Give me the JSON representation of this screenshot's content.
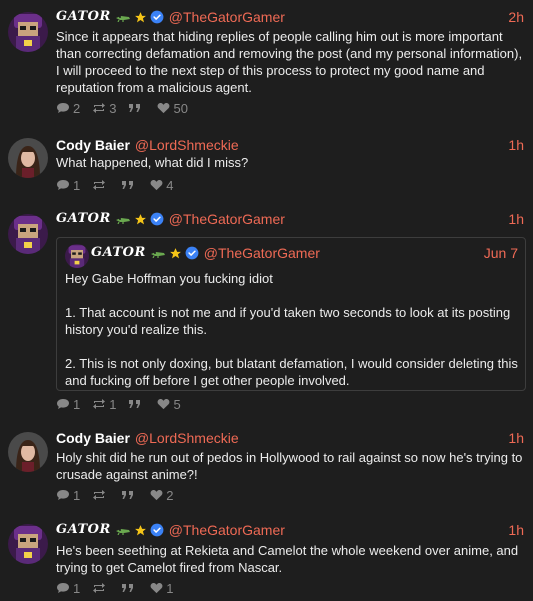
{
  "posts": [
    {
      "author": "GATOR",
      "handle": "@TheGatorGamer",
      "time": "2h",
      "text": [
        "Since it appears that hiding replies of people calling him out is more important than correcting defamation and removing the post (and my personal information), I will proceed to the next step of this process to protect my good name and reputation from a malicious agent."
      ],
      "replies": "2",
      "reposts": "3",
      "likes": "50"
    },
    {
      "author": "Cody Baier",
      "handle": "@LordShmeckie",
      "time": "1h",
      "text": [
        "What happened, what did I miss?"
      ],
      "replies": "1",
      "reposts": "",
      "likes": "4"
    },
    {
      "author": "GATOR",
      "handle": "@TheGatorGamer",
      "time": "1h",
      "replies": "1",
      "reposts": "1",
      "likes": "5",
      "quote": {
        "author": "GATOR",
        "handle": "@TheGatorGamer",
        "time": "Jun 7",
        "text": [
          "Hey Gabe Hoffman you fucking idiot",
          "1. That account is not me and if you'd taken two seconds to look at its posting history you'd realize this.",
          "2. This is not only doxing, but blatant defamation, I would consider deleting this and fucking off before I get other people involved."
        ]
      }
    },
    {
      "author": "Cody Baier",
      "handle": "@LordShmeckie",
      "time": "1h",
      "text": [
        "Holy shit did he run out of pedos in Hollywood to rail against so now he's trying to crusade against anime?!"
      ],
      "replies": "1",
      "reposts": "",
      "likes": "2"
    },
    {
      "author": "GATOR",
      "handle": "@TheGatorGamer",
      "time": "1h",
      "text": [
        "He's been seething at Rekieta and Camelot the whole weekend over anime, and trying to get Camelot fired from Nascar."
      ],
      "replies": "1",
      "reposts": "",
      "likes": "1"
    }
  ],
  "icons": {
    "reply": "speech-bubble-icon",
    "repost": "repost-arrows-icon",
    "quote": "quote-marks-icon",
    "like": "heart-icon",
    "verified": "verified-check-icon",
    "star": "star-icon",
    "gator_emoji": "alligator-icon"
  },
  "colors": {
    "background": "#1e1e1e",
    "accent": "#ef6a55",
    "text": "#ececec",
    "muted": "#888888",
    "verified": "#3b82f6",
    "star": "#f5c518"
  }
}
